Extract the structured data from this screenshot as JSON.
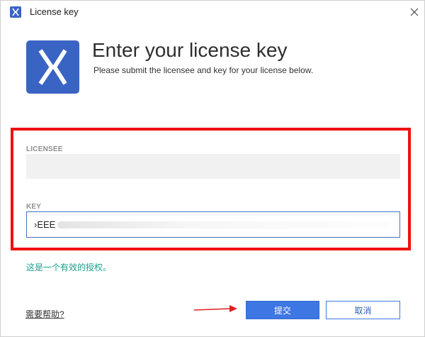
{
  "window": {
    "title": "License key"
  },
  "header": {
    "title": "Enter your license key",
    "subtitle": "Please submit the licensee and key for your license below."
  },
  "form": {
    "licensee_label": "LICENSEE",
    "licensee_value": "",
    "key_label": "KEY",
    "key_value": "›EEE"
  },
  "status": {
    "message": "这是一个有效的授权。"
  },
  "footer": {
    "help_link": "需要帮助?",
    "submit_label": "提交",
    "cancel_label": "取消"
  },
  "colors": {
    "brand": "#3a64c4",
    "primary_button": "#3e77e3",
    "highlight": "#ee1111",
    "valid_text": "#1a9e8c",
    "annotation_arrow": "#e02020"
  },
  "icons": {
    "app": "app-logo-icon",
    "close": "close-icon",
    "annotation": "arrow-right-icon"
  }
}
